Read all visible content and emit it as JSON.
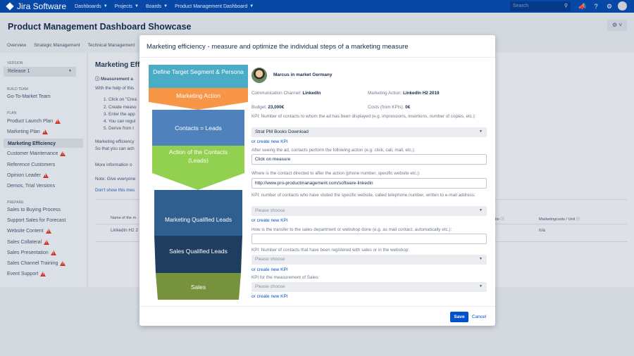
{
  "topbar": {
    "logo": "Jira Software",
    "nav": [
      "Dashboards",
      "Projects",
      "Boards",
      "Product Management Dashboard"
    ],
    "search_placeholder": "Search"
  },
  "header": {
    "title": "Product Management Dashboard Showcase",
    "tabs": [
      "Overview",
      "Strategic Management",
      "Technical Management"
    ]
  },
  "sidebar": {
    "version_label": "VERSION",
    "version_value": "Release 1",
    "build_team_label": "BUILD TEAM",
    "build_team_value": "Go-To-Market Team",
    "plan_label": "PLAN",
    "plan_items": [
      {
        "label": "Product Launch Plan",
        "warn": true
      },
      {
        "label": "Marketing Plan",
        "warn": true
      },
      {
        "label": "Marketing Efficiency",
        "warn": false,
        "active": true
      },
      {
        "label": "Customer Maintenance",
        "warn": true
      },
      {
        "label": "Reference Customers",
        "warn": false
      },
      {
        "label": "Opinion Leader",
        "warn": true
      },
      {
        "label": "Demos, Trial Versions",
        "warn": false
      }
    ],
    "prepare_label": "PREPARE",
    "prepare_items": [
      {
        "label": "Sales to Buying Process",
        "warn": false
      },
      {
        "label": "Support Sales for Forecast",
        "warn": false
      },
      {
        "label": "Website Content",
        "warn": true
      },
      {
        "label": "Sales Collateral",
        "warn": true
      },
      {
        "label": "Sales Presentation",
        "warn": true
      },
      {
        "label": "Sales Channel Training",
        "warn": true
      },
      {
        "label": "Event Support",
        "warn": true
      }
    ]
  },
  "main": {
    "title": "Marketing Eff",
    "measurement": "Measurement a",
    "intro": "With the help of this",
    "steps": [
      "1. Click on \"Crea",
      "2. Create measu",
      "3. Enter the app",
      "4. You can regul",
      "5. Derive from t"
    ],
    "para1": "Marketing efficiency",
    "para2": "So that you can ach",
    "more_info": "More information o",
    "note": "Note: Give everyone",
    "dont_show": "Don't show this mes",
    "table_col1": "Name of the m",
    "table_col_ratio": "tio",
    "table_col_costs": "Marketingcosts / Unit",
    "table_row_name": "LinkedIn H2 2",
    "table_row_costs": "n/a"
  },
  "modal": {
    "title": "Marketing efficiency - measure and optimize the individual steps of a marketing measure",
    "funnel": [
      "Define Target Segment & Persona",
      "Marketing Action",
      "Contacts = Leads",
      "Action of the Contacts (Leads)",
      "Marketing Qualified Leads",
      "Sales Qualified Leads",
      "Sales"
    ],
    "funnel_colors": [
      "#4bacc6",
      "#f79646",
      "#4f81bd",
      "#92d050",
      "#2f5f8f",
      "#1f3d5e",
      "#76923c"
    ],
    "persona": "Marcus in market Germany",
    "channel_label": "Communication Channel:",
    "channel_value": "LinkedIn",
    "action_label": "Marketing Action:",
    "action_value": "LinkedIn H2 2019",
    "budget_label": "Budget:",
    "budget_value": "23,000€",
    "costs_label": "Costs (from KPIs):",
    "costs_value": "0€",
    "kpi1_label": "KPI: Number of contacts to whom the ad has been displayed (e.g. impressions, insertions, number of copies, etc.):",
    "kpi1_value": "Strat PM Books Download",
    "create_kpi": "or create new KPI",
    "action_q": "After seeing the ad, contacts perform the following action (e.g. click, call, mail, etc.):",
    "action_input": "Click on measure",
    "directed_q": "Where is the contact directed to after the action (phone number, specific website etc.):",
    "directed_input": "http://www.pro-productmanagement.com/software-linkedin",
    "kpi2_label": "KPI: number of contacts who have visited the specific website, called telephone number, written to e-mail address:",
    "placeholder": "Please choose",
    "transfer_q": "How is the transfer to the sales department or webshop done (e.g. as mail contact, automatically etc.):",
    "transfer_input": "",
    "kpi3_label": "KPI: Number of contacts that have been registered with sales or in the webshop:",
    "kpi4_label": "KPI for the measurement of Sales:",
    "save": "Save",
    "cancel": "Cancel"
  }
}
